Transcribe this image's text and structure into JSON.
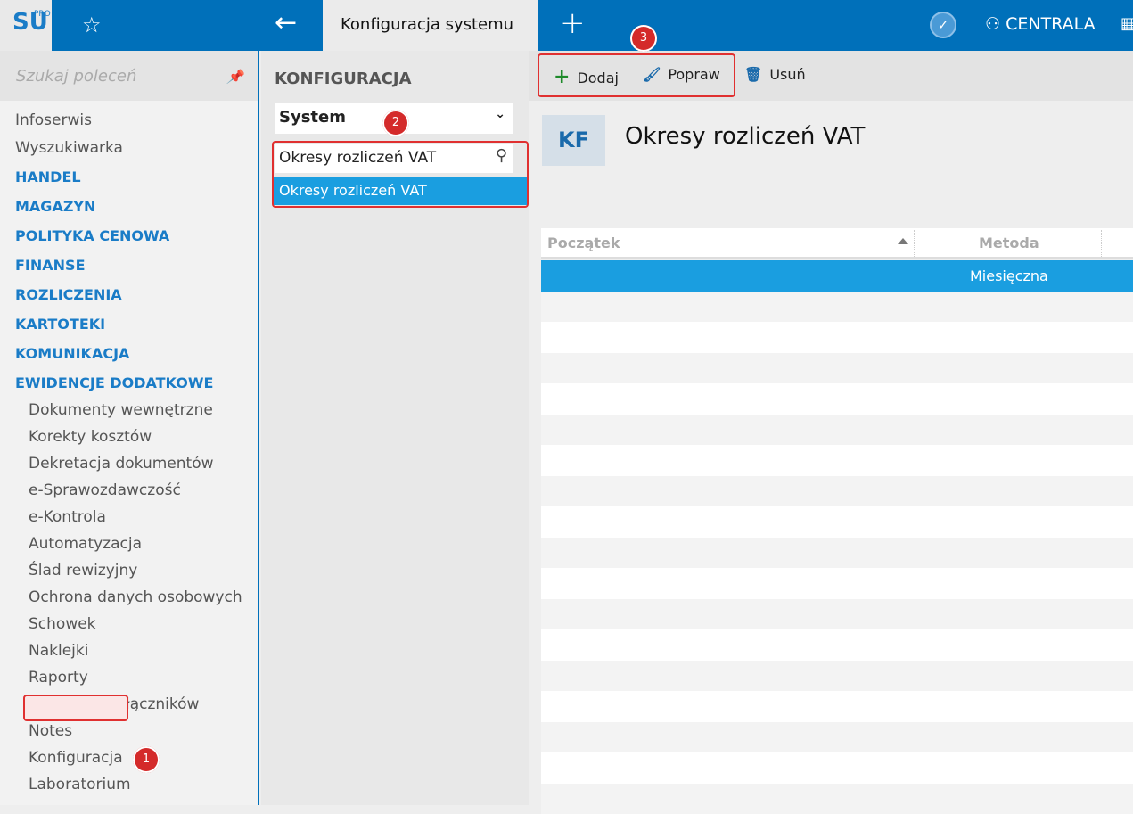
{
  "header": {
    "logo": "SU",
    "logo_sup": "PRO",
    "tab_title": "Konfiguracja systemu",
    "company": "CENTRALA"
  },
  "sidebar": {
    "search_placeholder": "Szukaj poleceń",
    "top_items": [
      "Infoserwis",
      "Wyszukiwarka"
    ],
    "sections": [
      "HANDEL",
      "MAGAZYN",
      "POLITYKA CENOWA",
      "FINANSE",
      "ROZLICZENIA",
      "KARTOTEKI",
      "KOMUNIKACJA",
      "EWIDENCJE DODATKOWE"
    ],
    "sub_items": [
      "Dokumenty wewnętrzne",
      "Korekty kosztów",
      "Dekretacja dokumentów",
      "e-Sprawozdawczość",
      "e-Kontrola",
      "Automatyzacja",
      "Ślad rewizyjny",
      "Ochrona danych osobowych",
      "Schowek",
      "Naklejki",
      "Raporty",
      "Biblioteka załączników",
      "Notes",
      "Konfiguracja",
      "Laboratorium"
    ]
  },
  "middle": {
    "title": "KONFIGURACJA",
    "dropdown_value": "System",
    "filter_value": "Okresy rozliczeń VAT",
    "selected_item": "Okresy rozliczeń VAT"
  },
  "toolbar": {
    "add": "Dodaj",
    "edit": "Popraw",
    "delete": "Usuń"
  },
  "badges": [
    "1",
    "2",
    "3"
  ],
  "main": {
    "avatar": "KF",
    "title": "Okresy rozliczeń VAT",
    "columns": [
      "Początek",
      "Metoda"
    ],
    "rows": [
      {
        "poczatek": "",
        "metoda": "Miesięczna"
      }
    ]
  },
  "colors": {
    "brand": "#0070ba",
    "selection": "#1a9ee0",
    "highlight": "#e03030"
  }
}
